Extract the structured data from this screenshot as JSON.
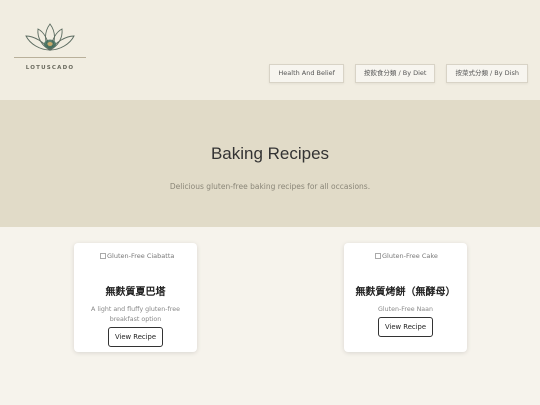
{
  "brand": {
    "name": "LOTUSCADO"
  },
  "nav": {
    "items": [
      {
        "label": "Health And Belief"
      },
      {
        "label": "按飲食分類 / By Diet"
      },
      {
        "label": "按菜式分類 / By Dish"
      }
    ]
  },
  "hero": {
    "title": "Baking Recipes",
    "subtitle": "Delicious gluten-free baking recipes for all occasions."
  },
  "cards": [
    {
      "image_alt": "Gluten-Free Ciabatta",
      "title": "無麩質夏巴塔",
      "description": "A light and fluffy gluten-free breakfast option",
      "button_label": "View Recipe"
    },
    {
      "image_alt": "Gluten-Free Cake",
      "title": "無麩質烤餅（無酵母）",
      "description": "Gluten-Free Naan",
      "button_label": "View Recipe"
    }
  ],
  "colors": {
    "header_bg": "#f1ede1",
    "hero_bg": "#e1dbc8",
    "page_bg": "#f6f3ec",
    "logo_accent": "#3f6b5a"
  },
  "icons": {
    "logo": "lotus-icon",
    "broken_image": "broken-image-icon"
  }
}
